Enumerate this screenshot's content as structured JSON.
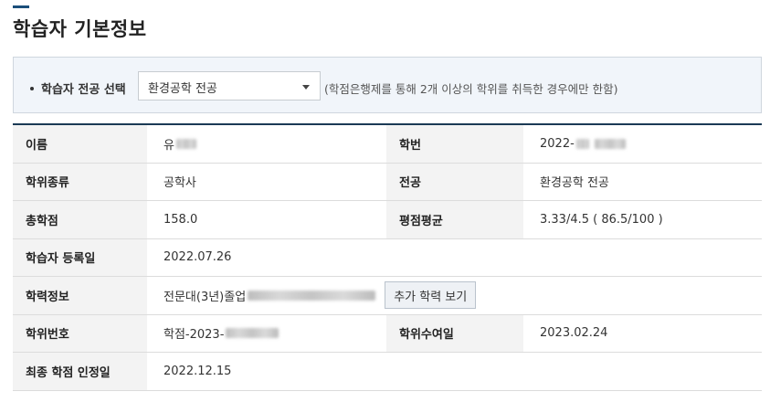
{
  "page": {
    "title": "학습자 기본정보"
  },
  "major_select": {
    "label": "학습자 전공 선택",
    "selected": "환경공학 전공",
    "note": "(학점은행제를 통해 2개 이상의 학위를 취득한 경우에만 한함)"
  },
  "info": {
    "name_label": "이름",
    "name_value": "유",
    "student_id_label": "학번",
    "student_id_value": "2022-",
    "degree_type_label": "학위종류",
    "degree_type_value": "공학사",
    "major_label": "전공",
    "major_value": "환경공학 전공",
    "total_credits_label": "총학점",
    "total_credits_value": "158.0",
    "gpa_label": "평점평균",
    "gpa_value": "3.33/4.5 ( 86.5/100 )",
    "registration_date_label": "학습자 등록일",
    "registration_date_value": "2022.07.26",
    "education_label": "학력정보",
    "education_value": "전문대(3년)졸업",
    "more_education_button": "추가 학력 보기",
    "degree_number_label": "학위번호",
    "degree_number_value": "학점-2023-",
    "degree_award_date_label": "학위수여일",
    "degree_award_date_value": "2023.02.24",
    "final_credit_date_label": "최종 학점 인정일",
    "final_credit_date_value": "2022.12.15"
  },
  "colors": {
    "accent": "#1b4f7a",
    "header_bg": "#f3f3f3",
    "select_panel_bg": "#f1f5fa"
  }
}
